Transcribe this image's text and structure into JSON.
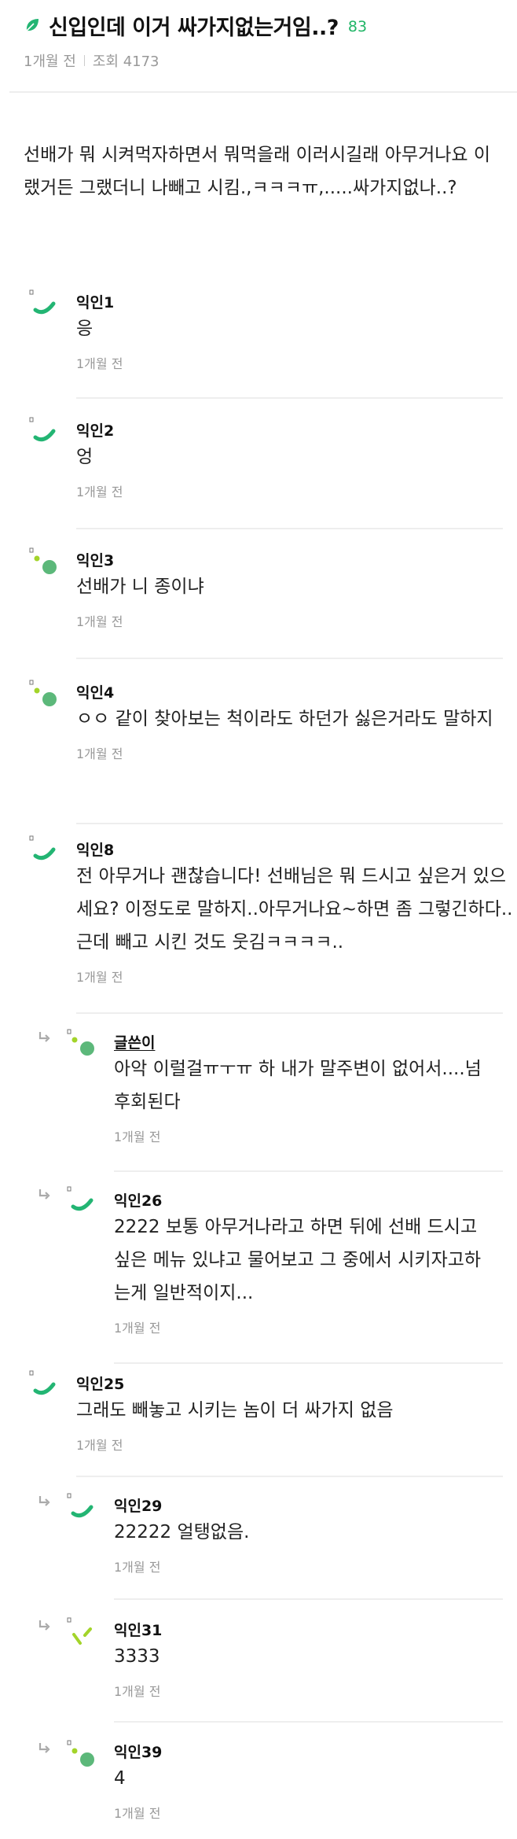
{
  "post": {
    "title": "신입인데 이거 싸가지없는거임..?",
    "comment_count": "83",
    "time": "1개월 전",
    "views": "조회 4173",
    "body": "선배가 뭐 시켜먹자하면서 뭐먹을래 이러시길래 아무거나요 이랬거든 그랬더니 나빼고 시킴.,ㅋㅋㅋㅠ,.....싸가지없나..?"
  },
  "comments": [
    {
      "author": "익인1",
      "text": "응",
      "time": "1개월 전",
      "reply": false,
      "avatar": "green-arc"
    },
    {
      "author": "익인2",
      "text": "엉",
      "time": "1개월 전",
      "reply": false,
      "avatar": "green-arc"
    },
    {
      "author": "익인3",
      "text": "선배가 니 종이냐",
      "time": "1개월 전",
      "reply": false,
      "avatar": "green-dots"
    },
    {
      "author": "익인4",
      "text": "ㅇㅇ 같이 찾아보는 척이라도 하던가 싫은거라도 말하지",
      "time": "1개월 전",
      "reply": false,
      "avatar": "green-dots"
    },
    {
      "author": "익인8",
      "text": "전 아무거나 괜찮습니다! 선배님은 뭐 드시고 싶은거 있으세요? 이정도로 말하지..아무거나요~하면 좀 그렇긴하다.. 근데 빼고 시킨 것도 웃김ㅋㅋㅋㅋ..",
      "time": "1개월 전",
      "reply": false,
      "avatar": "green-arc"
    },
    {
      "author": "글쓴이",
      "text": "아악 이럴걸ㅠㅜㅠ 하 내가 말주변이 없어서....넘 후회된다",
      "time": "1개월 전",
      "reply": true,
      "avatar": "green-dots"
    },
    {
      "author": "익인26",
      "text": "2222 보통 아무거나라고 하면 뒤에 선배 드시고 싶은 메뉴 있냐고 물어보고 그 중에서 시키자고하는게 일반적이지...",
      "time": "1개월 전",
      "reply": true,
      "avatar": "green-arc"
    },
    {
      "author": "익인25",
      "text": "그래도 빼놓고 시키는 놈이 더 싸가지 없음",
      "time": "1개월 전",
      "reply": false,
      "avatar": "green-arc"
    },
    {
      "author": "익인29",
      "text": "22222 얼탱없음.",
      "time": "1개월 전",
      "reply": true,
      "avatar": "green-arc"
    },
    {
      "author": "익인31",
      "text": "3333",
      "time": "1개월 전",
      "reply": true,
      "avatar": "lime-ticks"
    },
    {
      "author": "익인39",
      "text": "4",
      "time": "1개월 전",
      "reply": true,
      "avatar": "green-dots"
    }
  ],
  "colors": {
    "accent": "#1fb566",
    "avatar_green": "#23b573",
    "avatar_lime": "#a3d42a"
  }
}
